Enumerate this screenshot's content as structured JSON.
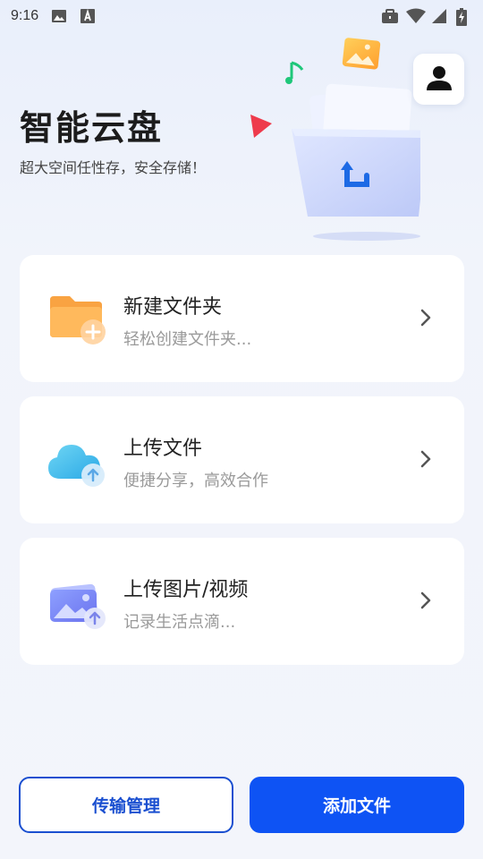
{
  "status_bar": {
    "time": "9:16",
    "icons": [
      "image-icon",
      "text-icon",
      "briefcase-icon",
      "wifi-icon",
      "signal-icon",
      "battery-charging-icon"
    ]
  },
  "header": {
    "title": "智能云盘",
    "subtitle": "超大空间任性存，安全存储！"
  },
  "actions": [
    {
      "title": "新建文件夹",
      "desc": "轻松创建文件夹...",
      "icon": "new-folder-icon"
    },
    {
      "title": "上传文件",
      "desc": "便捷分享，高效合作",
      "icon": "cloud-upload-icon"
    },
    {
      "title": "上传图片/视频",
      "desc": "记录生活点滴...",
      "icon": "image-upload-icon"
    }
  ],
  "footer": {
    "transfer_label": "传输管理",
    "add_file_label": "添加文件"
  },
  "colors": {
    "accent": "#0e53f4",
    "accent_border": "#1a4fd0"
  }
}
